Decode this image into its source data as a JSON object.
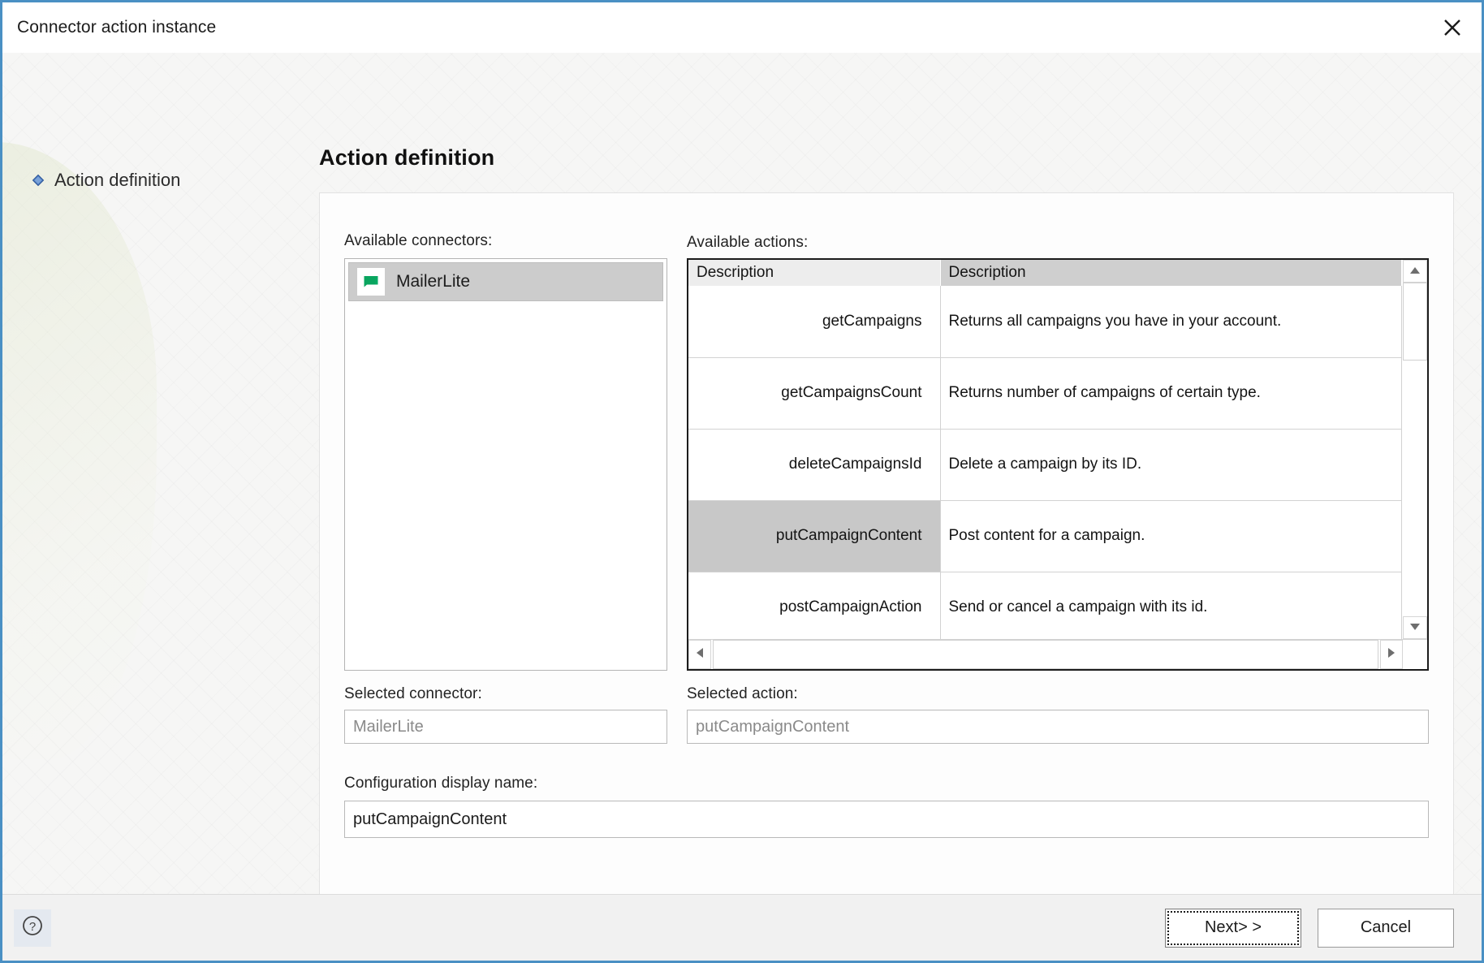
{
  "window": {
    "title": "Connector action instance",
    "close_icon": "close-icon"
  },
  "sidebar": {
    "items": [
      {
        "label": "Action definition",
        "bullet_icon": "diamond-bullet-icon"
      }
    ]
  },
  "main": {
    "page_title": "Action definition",
    "connectors": {
      "label": "Available connectors:",
      "items": [
        {
          "name": "MailerLite",
          "icon": "green-flag-icon",
          "selected": true
        }
      ]
    },
    "actions": {
      "label": "Available actions:",
      "columns": [
        "Description",
        "Description"
      ],
      "rows": [
        {
          "name": "getCampaigns",
          "description": "Returns all campaigns you have in your account.",
          "selected": false
        },
        {
          "name": "getCampaignsCount",
          "description": "Returns number of campaigns of certain type.",
          "selected": false
        },
        {
          "name": "deleteCampaignsId",
          "description": "Delete a campaign by its ID.",
          "selected": false
        },
        {
          "name": "putCampaignContent",
          "description": "Post content for a campaign.",
          "selected": true
        },
        {
          "name": "postCampaignAction",
          "description": "Send or cancel a campaign with its id.",
          "selected": false
        }
      ],
      "scroll_up_icon": "triangle-up-icon",
      "scroll_down_icon": "triangle-down-icon",
      "scroll_left_icon": "triangle-left-icon",
      "scroll_right_icon": "triangle-right-icon"
    },
    "selected_connector": {
      "label": "Selected connector:",
      "value": "MailerLite"
    },
    "selected_action": {
      "label": "Selected action:",
      "value": "putCampaignContent"
    },
    "config_display_name": {
      "label": "Configuration display name:",
      "value": "putCampaignContent"
    }
  },
  "footer": {
    "help_icon": "help-question-icon",
    "next_label": "Next> >",
    "cancel_label": "Cancel"
  },
  "colors": {
    "window_border": "#4a90c4",
    "accent_green": "#0aa55f",
    "selection_gray": "#c8c8c8",
    "header_gray": "#cfcfcf"
  }
}
